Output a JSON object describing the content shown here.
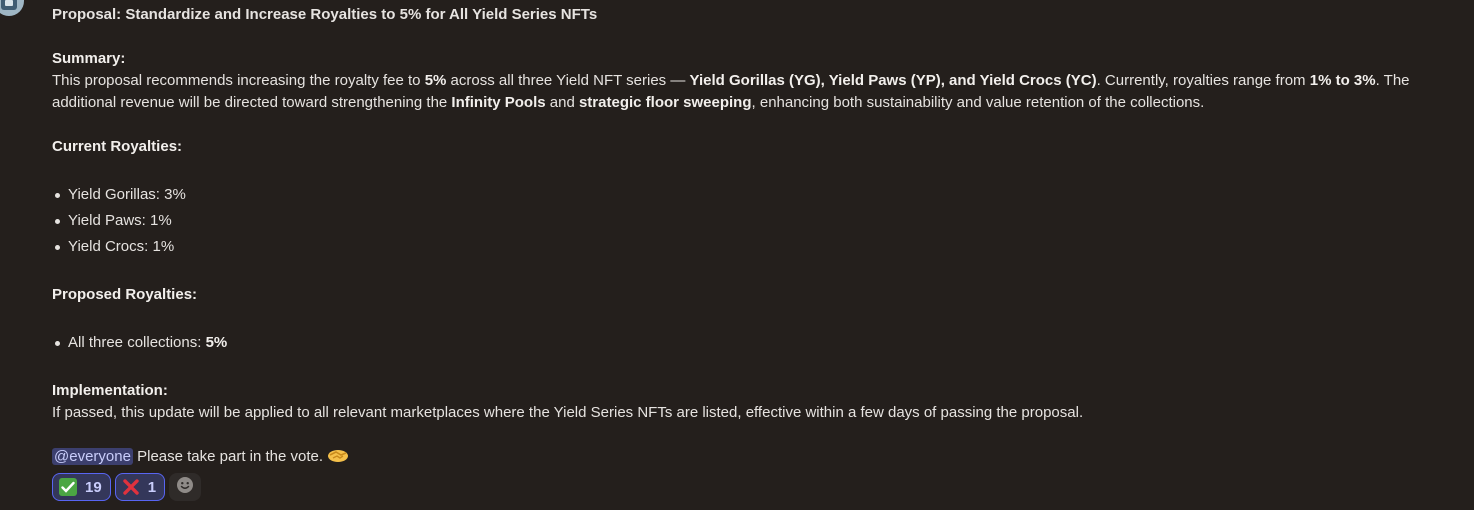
{
  "message": {
    "title": "Proposal: Standardize and Increase Royalties to 5% for All Yield Series NFTs",
    "summary_heading": "Summary:",
    "summary_line1": {
      "t1": "This proposal recommends increasing the royalty fee to ",
      "b1": "5%",
      "t2": " across all three Yield NFT series — ",
      "b2": "Yield Gorillas (YG), Yield Paws (YP), and Yield Crocs (YC)",
      "t3": ". Currently, royalties range from ",
      "b3": "1% to 3%",
      "t4": ". The"
    },
    "summary_line2": {
      "t1": "additional revenue will be directed toward strengthening the ",
      "b1": "Infinity Pools",
      "t2": " and ",
      "b2": "strategic floor sweeping",
      "t3": ", enhancing both sustainability and value retention of the collections."
    },
    "current_heading": "Current Royalties:",
    "current_items": [
      "Yield Gorillas: 3%",
      "Yield Paws: 1%",
      "Yield Crocs: 1%"
    ],
    "proposed_heading": "Proposed Royalties:",
    "proposed_item": {
      "text": "All three collections: ",
      "bold": "5%"
    },
    "implementation_heading": "Implementation:",
    "implementation_text": "If passed, this update will be applied to all relevant marketplaces where the Yield Series NFTs are listed, effective within a few days of passing the proposal.",
    "mention": "@everyone",
    "call_to_action": " Please take part in the vote. "
  },
  "reactions": [
    {
      "emoji": "check-mark-icon",
      "count": "19"
    },
    {
      "emoji": "cross-mark-icon",
      "count": "1"
    }
  ],
  "colors": {
    "background": "#241f1c",
    "text": "#e6e3e0",
    "mention_bg": "#3c3f6e",
    "reaction_border": "#5865f2",
    "reaction_bg": "#34375a"
  }
}
